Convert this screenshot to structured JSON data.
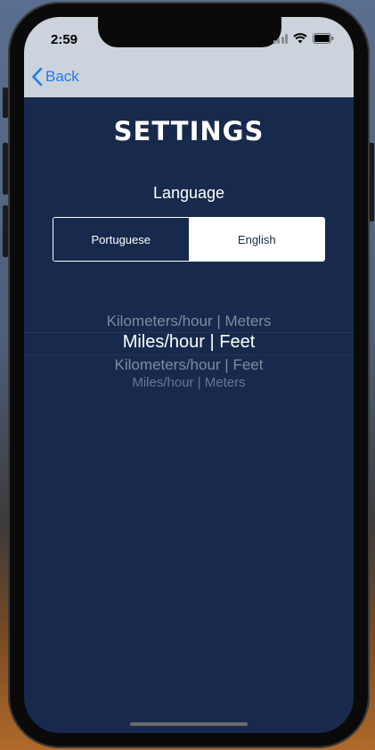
{
  "status_bar": {
    "time": "2:59"
  },
  "nav": {
    "back_label": "Back"
  },
  "screen": {
    "title": "SETTINGS",
    "language_label": "Language",
    "language_options": [
      {
        "label": "Portuguese",
        "selected": false
      },
      {
        "label": "English",
        "selected": true
      }
    ],
    "units_picker": {
      "items": [
        "Kilometers/hour | Meters",
        "Miles/hour | Feet",
        "Kilometers/hour | Feet",
        "Miles/hour | Meters"
      ],
      "selected_index": 1
    }
  },
  "colors": {
    "background": "#172a4d",
    "nav_background": "#cdd3dc",
    "accent": "#1e7cf2",
    "text": "#ffffff",
    "muted_text": "#7f8aa0"
  },
  "icons": [
    "chevron-left-icon",
    "signal-icon",
    "wifi-icon",
    "battery-icon"
  ]
}
